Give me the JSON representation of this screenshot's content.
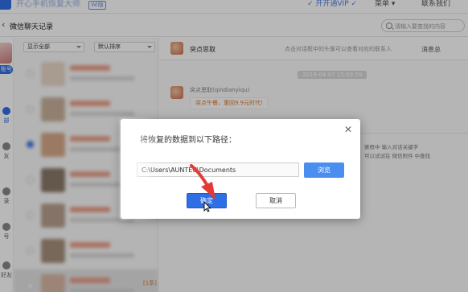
{
  "topbar": {
    "app_title": "开心手机恢复大师",
    "version": "Wi版",
    "menu": [
      "✓ 开开通VIP ✓",
      "菜单 ▾",
      "联系我们"
    ]
  },
  "header": {
    "back_icon": "back-arrow-icon",
    "title": "微信聊天记录",
    "search_placeholder": "请输入要查找的内容"
  },
  "rail": {
    "account_badge": "账号",
    "items": [
      "部",
      "友",
      "录",
      "号",
      "好友"
    ]
  },
  "contacts": {
    "filter_left": "显示全部",
    "filter_right": "默认排序",
    "unread": "[1条]"
  },
  "chat": {
    "contact_name": "突点思取",
    "hint": "点击对话框中的头像可以查看对应的联系人",
    "mode": "消息总",
    "time": "2019-04-07 15:59:59",
    "sender": "突点思取(qindianyiqu)",
    "message": "突点午餐，重回9.9元时代!",
    "side_hint_line1": "索框中 输入对话关键字",
    "side_hint_line2": "可以试试在 微信附件 中查找"
  },
  "dialog": {
    "title": "将恢复的数据到以下路径：",
    "path": "C:\\Users\\AUNTEC\\Documents",
    "browse_label": "浏览",
    "confirm_label": "确定",
    "cancel_label": "取消",
    "close_icon": "close-icon"
  },
  "colors": {
    "accent": "#2f6fe6",
    "annotation": "#e53935"
  }
}
